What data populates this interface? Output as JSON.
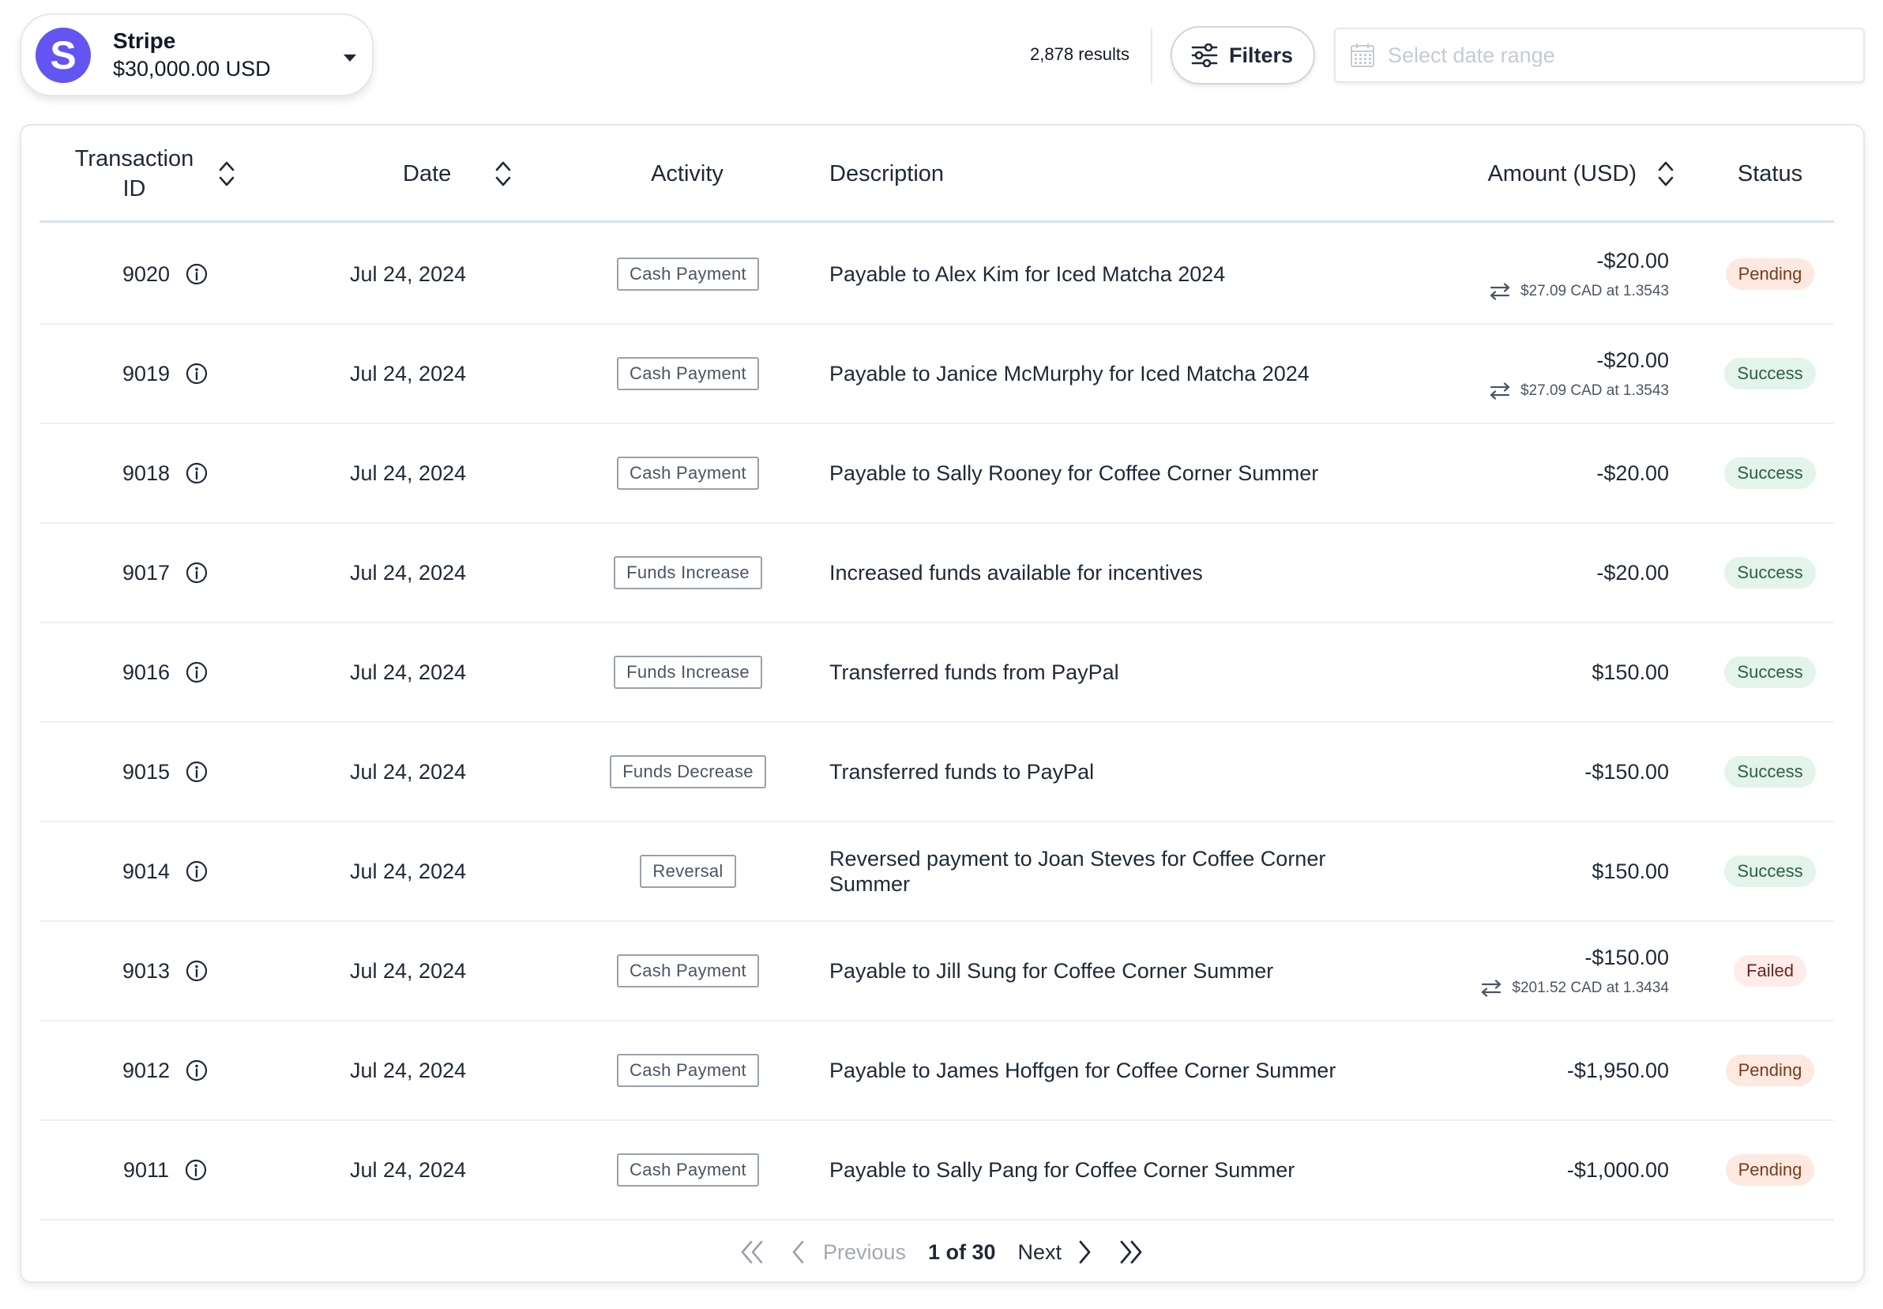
{
  "account": {
    "logo_letter": "S",
    "name": "Stripe",
    "balance": "$30,000.00 USD",
    "brand_color": "#6355f2"
  },
  "toolbar": {
    "results": "2,878 results",
    "filters_label": "Filters",
    "date_placeholder": "Select date range"
  },
  "table": {
    "headers": {
      "transaction_id": "Transaction ID",
      "date": "Date",
      "activity": "Activity",
      "description": "Description",
      "amount": "Amount (USD)",
      "status": "Status"
    },
    "rows": [
      {
        "id": "9020",
        "date": "Jul 24, 2024",
        "activity": "Cash Payment",
        "description": "Payable to Alex Kim for Iced Matcha 2024",
        "amount": "-$20.00",
        "fx": "$27.09 CAD at 1.3543",
        "status": "Pending"
      },
      {
        "id": "9019",
        "date": "Jul 24, 2024",
        "activity": "Cash Payment",
        "description": "Payable to Janice McMurphy for Iced Matcha 2024",
        "amount": "-$20.00",
        "fx": "$27.09 CAD at 1.3543",
        "status": "Success"
      },
      {
        "id": "9018",
        "date": "Jul 24, 2024",
        "activity": "Cash Payment",
        "description": "Payable to Sally Rooney for Coffee Corner Summer",
        "amount": "-$20.00",
        "fx": "",
        "status": "Success"
      },
      {
        "id": "9017",
        "date": "Jul 24, 2024",
        "activity": "Funds Increase",
        "description": "Increased funds available for incentives",
        "amount": "-$20.00",
        "fx": "",
        "status": "Success"
      },
      {
        "id": "9016",
        "date": "Jul 24, 2024",
        "activity": "Funds Increase",
        "description": "Transferred funds from PayPal",
        "amount": "$150.00",
        "fx": "",
        "status": "Success"
      },
      {
        "id": "9015",
        "date": "Jul 24, 2024",
        "activity": "Funds Decrease",
        "description": "Transferred funds to PayPal",
        "amount": "-$150.00",
        "fx": "",
        "status": "Success"
      },
      {
        "id": "9014",
        "date": "Jul 24, 2024",
        "activity": "Reversal",
        "description": "Reversed payment to Joan Steves for Coffee Corner Summer",
        "amount": "$150.00",
        "fx": "",
        "status": "Success"
      },
      {
        "id": "9013",
        "date": "Jul 24, 2024",
        "activity": "Cash Payment",
        "description": "Payable to Jill Sung for Coffee Corner Summer",
        "amount": "-$150.00",
        "fx": "$201.52 CAD at 1.3434",
        "status": "Failed"
      },
      {
        "id": "9012",
        "date": "Jul 24, 2024",
        "activity": "Cash Payment",
        "description": "Payable to James Hoffgen for Coffee Corner Summer",
        "amount": "-$1,950.00",
        "fx": "",
        "status": "Pending"
      },
      {
        "id": "9011",
        "date": "Jul 24, 2024",
        "activity": "Cash Payment",
        "description": "Payable to Sally Pang for Coffee Corner Summer",
        "amount": "-$1,000.00",
        "fx": "",
        "status": "Pending"
      }
    ]
  },
  "pagination": {
    "previous_label": "Previous",
    "current": "1 of 30",
    "next_label": "Next"
  },
  "icons": {
    "filters": "sliders-icon",
    "date": "calendar-icon",
    "info": "info-circle-icon",
    "fx": "exchange-arrows-icon",
    "sort": "sort-chevrons-icon"
  },
  "status_colors": {
    "Success": "#e3f4ea",
    "Pending": "#fde9df",
    "Failed": "#fdecea"
  }
}
